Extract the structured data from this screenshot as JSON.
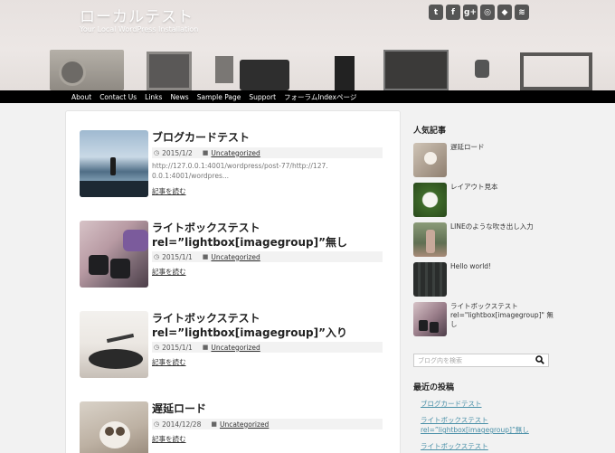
{
  "site": {
    "title": "ローカルテスト",
    "description": "Your Local WordPress Installation"
  },
  "social_icons": [
    "twitter-icon",
    "facebook-icon",
    "google-plus-icon",
    "instagram-icon",
    "feedly-icon",
    "rss-icon"
  ],
  "social_glyphs": [
    "t",
    "f",
    "g+",
    "◎",
    "◆",
    "≋"
  ],
  "nav": [
    "About",
    "Contact Us",
    "Links",
    "News",
    "Sample Page",
    "Support",
    "フォーラムIndexページ"
  ],
  "posts": [
    {
      "title": "ブログカードテスト",
      "date": "2015/1/2",
      "category": "Uncategorized",
      "excerpt": "http://127.0.0.1:4001/wordpress/post-77/http://127.0.0.1:4001/wordpres...",
      "more": "記事を読む"
    },
    {
      "title": "ライトボックステスト rel=”lightbox[imagegroup]”無し",
      "date": "2015/1/1",
      "category": "Uncategorized",
      "more": "記事を読む"
    },
    {
      "title": "ライトボックステスト rel=”lightbox[imagegroup]”入り",
      "date": "2015/1/1",
      "category": "Uncategorized",
      "more": "記事を読む"
    },
    {
      "title": "遅延ロード",
      "date": "2014/12/28",
      "category": "Uncategorized",
      "more": "記事を読む"
    }
  ],
  "sidebar": {
    "popular_heading": "人気記事",
    "popular": [
      "遅延ロード",
      "レイアウト見本",
      "LINEのような吹き出し入力",
      "Hello world!",
      "ライトボックステスト rel=\"lightbox[imagegroup]\" 無し"
    ],
    "search_placeholder": "ブログ内を検索",
    "recent_heading": "最近の投稿",
    "recent": [
      "ブログカードテスト",
      "ライトボックステスト rel=”lightbox[imagegroup]”無し",
      "ライトボックステスト"
    ]
  },
  "colors": {
    "nav_bg": "#000000",
    "link": "#4a90a8",
    "page_bg": "#f2f2f2"
  }
}
